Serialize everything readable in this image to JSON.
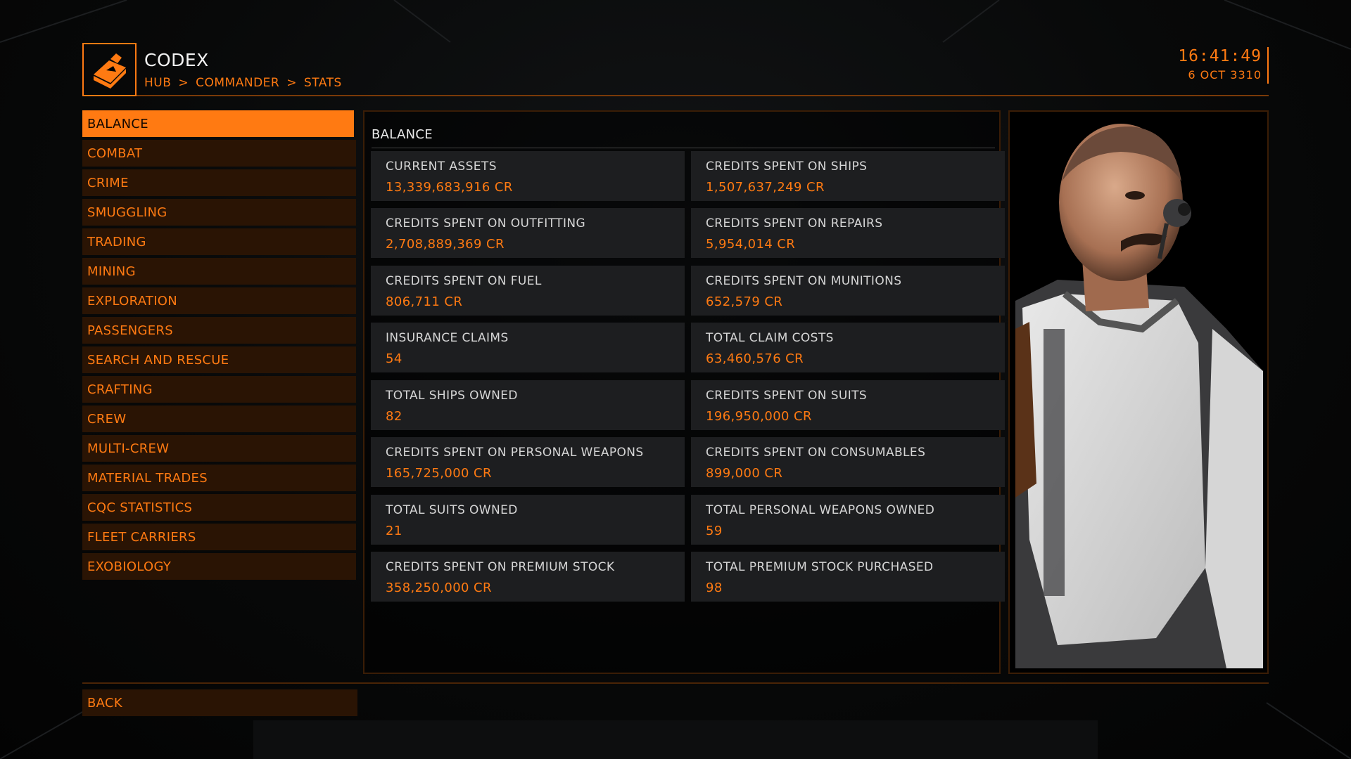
{
  "header": {
    "title": "CODEX",
    "breadcrumb": [
      "HUB",
      "COMMANDER",
      "STATS"
    ],
    "separator": ">",
    "time": "16:41:49",
    "date": "6 OCT 3310",
    "logo_icon": "codex-book-icon"
  },
  "sidebar": {
    "items": [
      {
        "label": "BALANCE",
        "active": true
      },
      {
        "label": "COMBAT"
      },
      {
        "label": "CRIME"
      },
      {
        "label": "SMUGGLING"
      },
      {
        "label": "TRADING"
      },
      {
        "label": "MINING"
      },
      {
        "label": "EXPLORATION"
      },
      {
        "label": "PASSENGERS"
      },
      {
        "label": "SEARCH AND RESCUE"
      },
      {
        "label": "CRAFTING"
      },
      {
        "label": "CREW"
      },
      {
        "label": "MULTI-CREW"
      },
      {
        "label": "MATERIAL TRADES"
      },
      {
        "label": "CQC STATISTICS"
      },
      {
        "label": "FLEET CARRIERS"
      },
      {
        "label": "EXOBIOLOGY"
      }
    ]
  },
  "main": {
    "title": "BALANCE",
    "stats": [
      {
        "label": "CURRENT ASSETS",
        "value": "13,339,683,916 CR"
      },
      {
        "label": "CREDITS SPENT ON SHIPS",
        "value": "1,507,637,249 CR"
      },
      {
        "label": "CREDITS SPENT ON OUTFITTING",
        "value": "2,708,889,369 CR"
      },
      {
        "label": "CREDITS SPENT ON REPAIRS",
        "value": "5,954,014 CR"
      },
      {
        "label": "CREDITS SPENT ON FUEL",
        "value": "806,711 CR"
      },
      {
        "label": "CREDITS SPENT ON MUNITIONS",
        "value": "652,579 CR"
      },
      {
        "label": "INSURANCE CLAIMS",
        "value": "54"
      },
      {
        "label": "TOTAL CLAIM COSTS",
        "value": "63,460,576 CR"
      },
      {
        "label": "TOTAL SHIPS OWNED",
        "value": "82"
      },
      {
        "label": "CREDITS SPENT ON SUITS",
        "value": "196,950,000 CR"
      },
      {
        "label": "CREDITS SPENT ON PERSONAL WEAPONS",
        "value": "165,725,000 CR"
      },
      {
        "label": "CREDITS SPENT ON CONSUMABLES",
        "value": "899,000 CR"
      },
      {
        "label": "TOTAL SUITS OWNED",
        "value": "21"
      },
      {
        "label": "TOTAL PERSONAL WEAPONS OWNED",
        "value": "59"
      },
      {
        "label": "CREDITS SPENT ON PREMIUM STOCK",
        "value": "358,250,000 CR"
      },
      {
        "label": "TOTAL PREMIUM STOCK PURCHASED",
        "value": "98"
      }
    ]
  },
  "footer": {
    "back_label": "BACK"
  },
  "colors": {
    "accent": "#ff7a12",
    "panel": "#1d1e20",
    "nav_bg": "#2a1404"
  }
}
